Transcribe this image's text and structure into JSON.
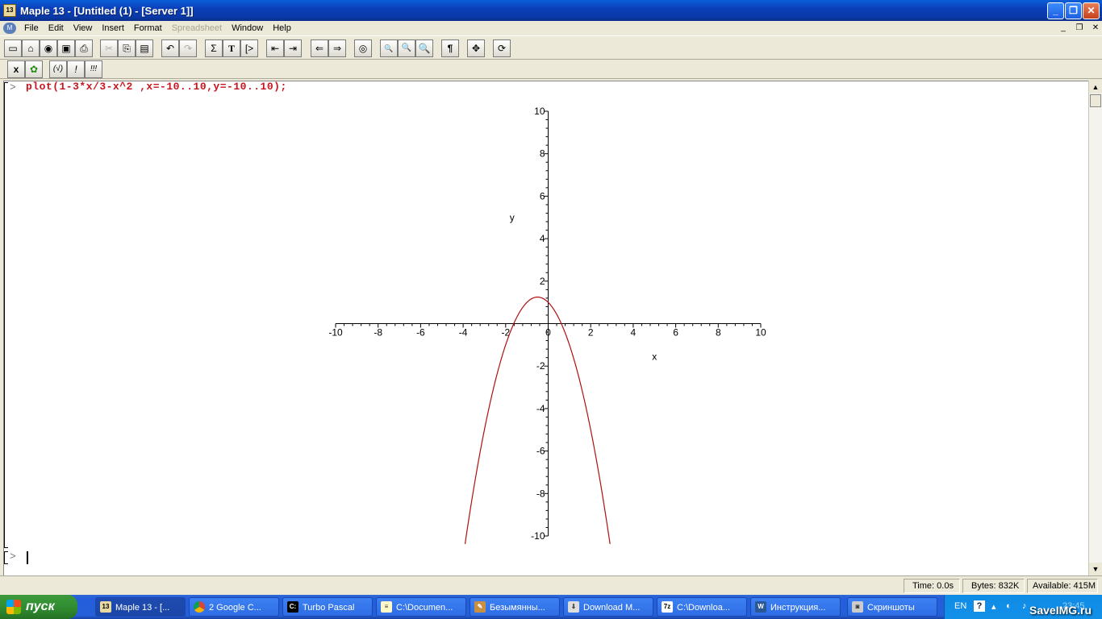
{
  "window": {
    "title": "Maple 13  - [Untitled (1) - [Server 1]]",
    "app_icon_text": "13",
    "controls": {
      "minimize": "_",
      "restore": "❐",
      "close": "✕"
    }
  },
  "menu": {
    "items": [
      "File",
      "Edit",
      "View",
      "Insert",
      "Format",
      "Spreadsheet",
      "Window",
      "Help"
    ],
    "disabled": [
      "Spreadsheet"
    ],
    "mdi_controls": {
      "minimize": "_",
      "restore": "❐",
      "close": "✕"
    }
  },
  "toolbar": {
    "buttons": [
      "new",
      "open",
      "open-url",
      "save",
      "print",
      "cut",
      "copy",
      "paste",
      "undo",
      "redo",
      "Σ",
      "T",
      "[>",
      "outdent",
      "indent",
      "back",
      "forward",
      "stop",
      "zoom-100",
      "zoom-150",
      "zoom-200",
      "¶",
      "move",
      "restart"
    ],
    "math_buttons": [
      "x",
      "maple-leaf",
      "(√)",
      "!",
      "!!!"
    ]
  },
  "worksheet": {
    "prompt": "[>",
    "command": "plot(1-3*x/3-x^2 ,x=-10..10,y=-10..10);",
    "prompt2": "[>"
  },
  "chart_data": {
    "type": "line",
    "expression": "1-3*x/3-x^2",
    "series": [
      {
        "color": "#b01010",
        "x": [
          -3.91,
          -3.5,
          -3,
          -2.5,
          -2,
          -1.5,
          -1,
          -0.5,
          0,
          0.5,
          1,
          1.5,
          2,
          2.5,
          2.91
        ],
        "y": [
          -10,
          -7.75,
          -5,
          -2.75,
          -1,
          0.25,
          1,
          1.25,
          1,
          0.25,
          -1,
          -2.75,
          -5,
          -7.75,
          -10
        ]
      }
    ],
    "xlabel": "x",
    "ylabel": "y",
    "xlim": [
      -10,
      10
    ],
    "ylim": [
      -10,
      10
    ],
    "x_ticks": [
      "-10",
      "-8",
      "-6",
      "-4",
      "-2",
      "0",
      "2",
      "4",
      "6",
      "8",
      "10"
    ],
    "y_ticks": [
      "-10",
      "-8",
      "-6",
      "-4",
      "-2",
      "2",
      "4",
      "6",
      "8",
      "10"
    ],
    "grid": false
  },
  "status": {
    "time": "Time:  0.0s",
    "bytes": "Bytes:  832K",
    "available": "Available:  415M"
  },
  "taskbar": {
    "start_label": "пуск",
    "tasks": [
      {
        "label": "Maple 13 - [...",
        "icon": "maple-icon",
        "active": true
      },
      {
        "label": "2 Google C...",
        "icon": "chrome-icon",
        "active": false
      },
      {
        "label": "Turbo Pascal",
        "icon": "console-icon",
        "active": false
      },
      {
        "label": "C:\\Documen...",
        "icon": "notepad-icon",
        "active": false
      },
      {
        "label": "Безымянны...",
        "icon": "paint-icon",
        "active": false
      },
      {
        "label": "Download M...",
        "icon": "download-icon",
        "active": false
      },
      {
        "label": "C:\\Downloa...",
        "icon": "7zip-icon",
        "active": false
      },
      {
        "label": "Инструкция...",
        "icon": "word-icon",
        "active": false
      },
      {
        "label": "Скриншоты",
        "icon": "camera-icon",
        "active": false
      }
    ],
    "tray": {
      "lang": "EN",
      "clock": "23:45"
    },
    "watermark": "SaveIMG.ru"
  }
}
